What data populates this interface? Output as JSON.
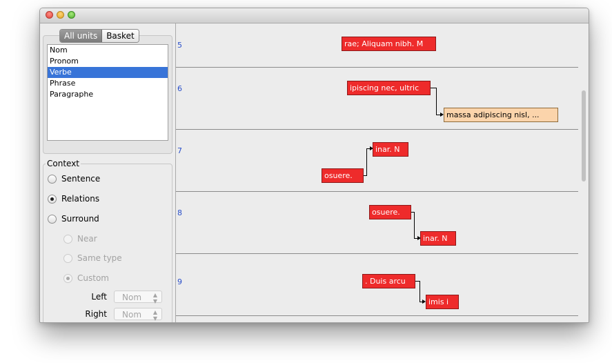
{
  "window": {
    "traffic_lights": [
      "close",
      "minimize",
      "zoom"
    ]
  },
  "tabs": [
    {
      "label": "All units",
      "active": true
    },
    {
      "label": "Basket",
      "active": false
    }
  ],
  "unit_list": {
    "items": [
      "Nom",
      "Pronom",
      "Verbe",
      "Phrase",
      "Paragraphe"
    ],
    "selected": "Verbe"
  },
  "context": {
    "legend": "Context",
    "options": {
      "sentence": "Sentence",
      "relations": "Relations",
      "surround": "Surround",
      "near": "Near",
      "same_type": "Same type",
      "custom": "Custom"
    },
    "selected": "Relations",
    "left_label": "Left",
    "left_value": "Nom",
    "right_label": "Right",
    "right_value": "Nom"
  },
  "sections": [
    {
      "number": "5",
      "units": [
        {
          "text": "rae; Aliquam nibh. M",
          "color": "red"
        }
      ]
    },
    {
      "number": "6",
      "units": [
        {
          "text": "ipiscing nec, ultric",
          "color": "red"
        },
        {
          "text": "massa adipiscing nisl, ...",
          "color": "peach"
        }
      ]
    },
    {
      "number": "7",
      "units": [
        {
          "text": "inar. N",
          "color": "red"
        },
        {
          "text": "osuere.",
          "color": "red"
        }
      ]
    },
    {
      "number": "8",
      "units": [
        {
          "text": "osuere.",
          "color": "red"
        },
        {
          "text": "inar. N",
          "color": "red"
        }
      ]
    },
    {
      "number": "9",
      "units": [
        {
          "text": ". Duis arcu",
          "color": "red"
        },
        {
          "text": "imis i",
          "color": "red"
        }
      ]
    }
  ],
  "colors": {
    "unit_red": "#ee2b2b",
    "unit_peach": "#fbd4ab",
    "selection": "#3874d8",
    "section_number": "#2a4fc9"
  }
}
